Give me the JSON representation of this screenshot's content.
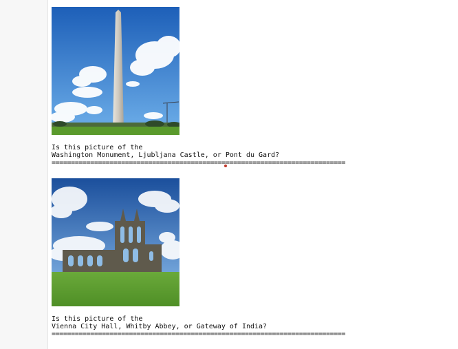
{
  "cells": [
    {
      "image_icon": "washington-monument-photo",
      "question_line1": "Is this picture of the",
      "question_line2": "Washington Monument, Ljubljana Castle, or Pont du Gard?",
      "separator": "============================================================================"
    },
    {
      "image_icon": "whitby-abbey-photo",
      "question_line1": "Is this picture of the",
      "question_line2": "Vienna City Hall, Whitby Abbey, or Gateway of India?",
      "separator": "============================================================================"
    }
  ],
  "colors": {
    "sky_top": "#1d5fb8",
    "sky_bottom": "#6fb0ea",
    "grass": "#5a9a2c",
    "stone": "#cfcac0",
    "ruin": "#5f5a4c",
    "marker": "#c0392b"
  }
}
